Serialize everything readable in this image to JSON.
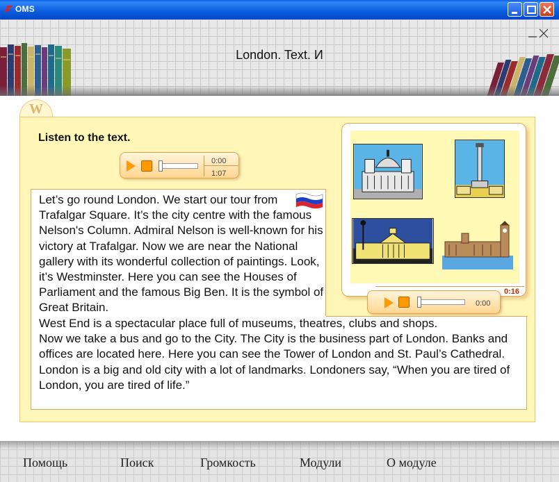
{
  "window": {
    "title": "OMS"
  },
  "header": {
    "title": "London. Text. И"
  },
  "exercise": {
    "instruction": "Listen to the text.",
    "player_main": {
      "elapsed": "0:00",
      "total": "1:07",
      "progress": 0
    },
    "player_picture": {
      "elapsed": "0:00",
      "total": "0:16",
      "progress": 0
    },
    "text_part1": "Let’s go round London. We start our tour from Trafalgar Square. It’s the  city centre with the famous Nelson's Column. Admiral Nelson is well-known for his victory at Trafalgar. Now we are near the National gallery with its wonderful collection of paintings. Look, it’s Westminster. Here you can see the Houses of Parliament and the famous Big Ben. It is the symbol of Great Britain.",
    "text_part2": "West End is a spectacular place full of museums, theatres, clubs and shops.",
    "text_part3": "Now we take a bus and go to the City. The City is the business part of London. Banks and offices are located here. Here you can see the Tower of London and St. Paul’s Cathedral.",
    "text_part4": "London is a big and old city with a lot of landmarks. Londoners say, “When you are tired of London, you are tired of life.”"
  },
  "icons": {
    "flag": "russian-flag-icon",
    "tab": "w-tab-icon",
    "pictures": [
      "st-pauls-cathedral-icon",
      "nelsons-column-icon",
      "national-gallery-icon",
      "houses-of-parliament-icon"
    ]
  },
  "menu": {
    "help": "Помощь",
    "search": "Поиск",
    "volume": "Громкость",
    "modules": "Модули",
    "about": "О модуле"
  },
  "colors": {
    "panel": "#fff6b8",
    "border": "#f2c46a",
    "accent": "#ff9a00",
    "titlebar": "#0b5fe0"
  }
}
